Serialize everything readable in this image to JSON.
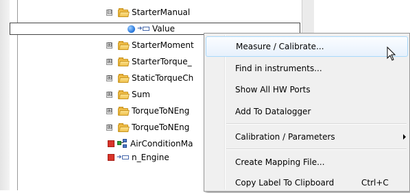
{
  "tree": {
    "items": [
      {
        "label": "StarterManual",
        "expander": "⊟",
        "icon": "folder-icon"
      },
      {
        "label": "Value",
        "icon": "port-icon"
      },
      {
        "label": "StarterMoment",
        "expander": "⊞",
        "icon": "folder-icon"
      },
      {
        "label": "StarterTorque_",
        "expander": "⊞",
        "icon": "folder-icon"
      },
      {
        "label": "StaticTorqueCh",
        "expander": "⊞",
        "icon": "folder-icon"
      },
      {
        "label": "Sum",
        "expander": "⊞",
        "icon": "folder-icon"
      },
      {
        "label": "TorqueToNEng",
        "expander": "⊞",
        "icon": "folder-icon"
      },
      {
        "label": "TorqueToNEng",
        "expander": "⊞",
        "icon": "folder-icon"
      },
      {
        "label": "AirConditionMa",
        "icon": "subsystem-icon"
      },
      {
        "label": "n_Engine",
        "icon": "port-icon"
      }
    ]
  },
  "context_menu": {
    "items": [
      {
        "label": "Measure / Calibrate...",
        "highlighted": true
      },
      {
        "label": "Find in instruments..."
      },
      {
        "label": "Show All HW Ports"
      },
      {
        "label": "Add To Datalogger"
      },
      {
        "label": "Calibration / Parameters",
        "submenu": true
      },
      {
        "label": "Create Mapping File..."
      },
      {
        "label": "Copy Label To Clipboard",
        "shortcut": "Ctrl+C"
      }
    ]
  },
  "colors": {
    "menu_background": "#f0f0f0",
    "highlight_border": "#a8d8fb",
    "folder_yellow": "#f2c04a",
    "status_red": "#d9342a",
    "selection_blue": "#2f7de0"
  }
}
